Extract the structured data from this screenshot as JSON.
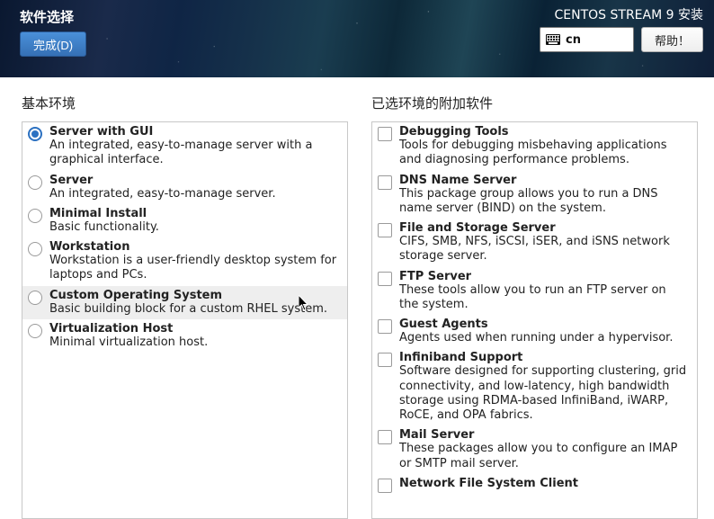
{
  "header": {
    "page_title": "软件选择",
    "installer_title": "CENTOS STREAM 9 安装",
    "done_button": "完成(D)",
    "help_button": "帮助！",
    "language": "cn"
  },
  "sections": {
    "base_env_title": "基本环境",
    "addons_title": "已选环境的附加软件"
  },
  "base_environments": [
    {
      "label": "Server with GUI",
      "description": "An integrated, easy-to-manage server with a graphical interface.",
      "selected": true
    },
    {
      "label": "Server",
      "description": "An integrated, easy-to-manage server.",
      "selected": false
    },
    {
      "label": "Minimal Install",
      "description": "Basic functionality.",
      "selected": false
    },
    {
      "label": "Workstation",
      "description": "Workstation is a user-friendly desktop system for laptops and PCs.",
      "selected": false
    },
    {
      "label": "Custom Operating System",
      "description": "Basic building block for a custom RHEL system.",
      "selected": false,
      "hover": true
    },
    {
      "label": "Virtualization Host",
      "description": "Minimal virtualization host.",
      "selected": false
    }
  ],
  "addons": [
    {
      "label": "Debugging Tools",
      "description": "Tools for debugging misbehaving applications and diagnosing performance problems.",
      "checked": false
    },
    {
      "label": "DNS Name Server",
      "description": "This package group allows you to run a DNS name server (BIND) on the system.",
      "checked": false
    },
    {
      "label": "File and Storage Server",
      "description": "CIFS, SMB, NFS, iSCSI, iSER, and iSNS network storage server.",
      "checked": false
    },
    {
      "label": "FTP Server",
      "description": "These tools allow you to run an FTP server on the system.",
      "checked": false
    },
    {
      "label": "Guest Agents",
      "description": "Agents used when running under a hypervisor.",
      "checked": false
    },
    {
      "label": "Infiniband Support",
      "description": "Software designed for supporting clustering, grid connectivity, and low-latency, high bandwidth storage using RDMA-based InfiniBand, iWARP, RoCE, and OPA fabrics.",
      "checked": false
    },
    {
      "label": "Mail Server",
      "description": "These packages allow you to configure an IMAP or SMTP mail server.",
      "checked": false
    },
    {
      "label": "Network File System Client",
      "description": "",
      "checked": false
    }
  ]
}
